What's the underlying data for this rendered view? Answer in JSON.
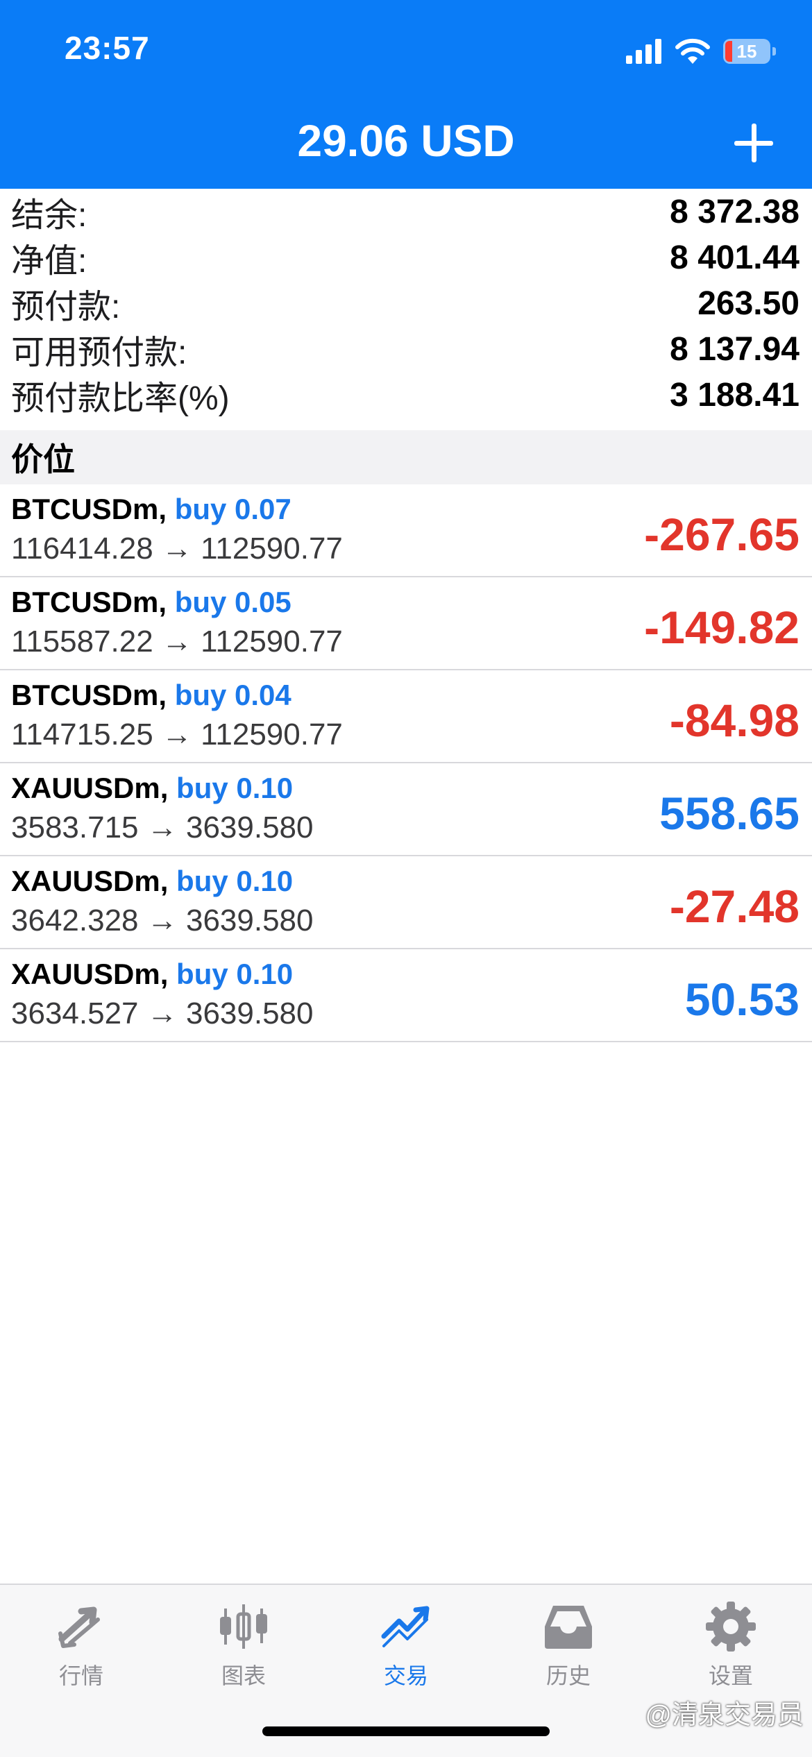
{
  "status_bar": {
    "time": "23:57",
    "battery": "15"
  },
  "header": {
    "title": "29.06 USD"
  },
  "summary": [
    {
      "label": "结余:",
      "value": "8 372.38"
    },
    {
      "label": "净值:",
      "value": "8 401.44"
    },
    {
      "label": "预付款:",
      "value": "263.50"
    },
    {
      "label": "可用预付款:",
      "value": "8 137.94"
    },
    {
      "label": "预付款比率(%)",
      "value": "3 188.41"
    }
  ],
  "section_title": "价位",
  "positions": [
    {
      "symbol": "BTCUSDm,",
      "action": "buy 0.07",
      "prices": "116414.28 → 112590.77",
      "profit": "-267.65"
    },
    {
      "symbol": "BTCUSDm,",
      "action": "buy 0.05",
      "prices": "115587.22 → 112590.77",
      "profit": "-149.82"
    },
    {
      "symbol": "BTCUSDm,",
      "action": "buy 0.04",
      "prices": "114715.25 → 112590.77",
      "profit": "-84.98"
    },
    {
      "symbol": "XAUUSDm,",
      "action": "buy 0.10",
      "prices": "3583.715 → 3639.580",
      "profit": "558.65"
    },
    {
      "symbol": "XAUUSDm,",
      "action": "buy 0.10",
      "prices": "3642.328 → 3639.580",
      "profit": "-27.48"
    },
    {
      "symbol": "XAUUSDm,",
      "action": "buy 0.10",
      "prices": "3634.527 → 3639.580",
      "profit": "50.53"
    }
  ],
  "tabs": [
    {
      "label": "行情",
      "icon": "quotes-arrows-icon"
    },
    {
      "label": "图表",
      "icon": "candlestick-chart-icon"
    },
    {
      "label": "交易",
      "icon": "trade-trend-icon",
      "active": true
    },
    {
      "label": "历史",
      "icon": "history-inbox-icon"
    },
    {
      "label": "设置",
      "icon": "gear-icon"
    }
  ],
  "watermark": "@清泉交易员",
  "colors": {
    "accent": "#0a7cf7",
    "profit_negative": "#e2352b",
    "profit_positive": "#1a78ea",
    "tab_inactive": "#8e8e93"
  }
}
